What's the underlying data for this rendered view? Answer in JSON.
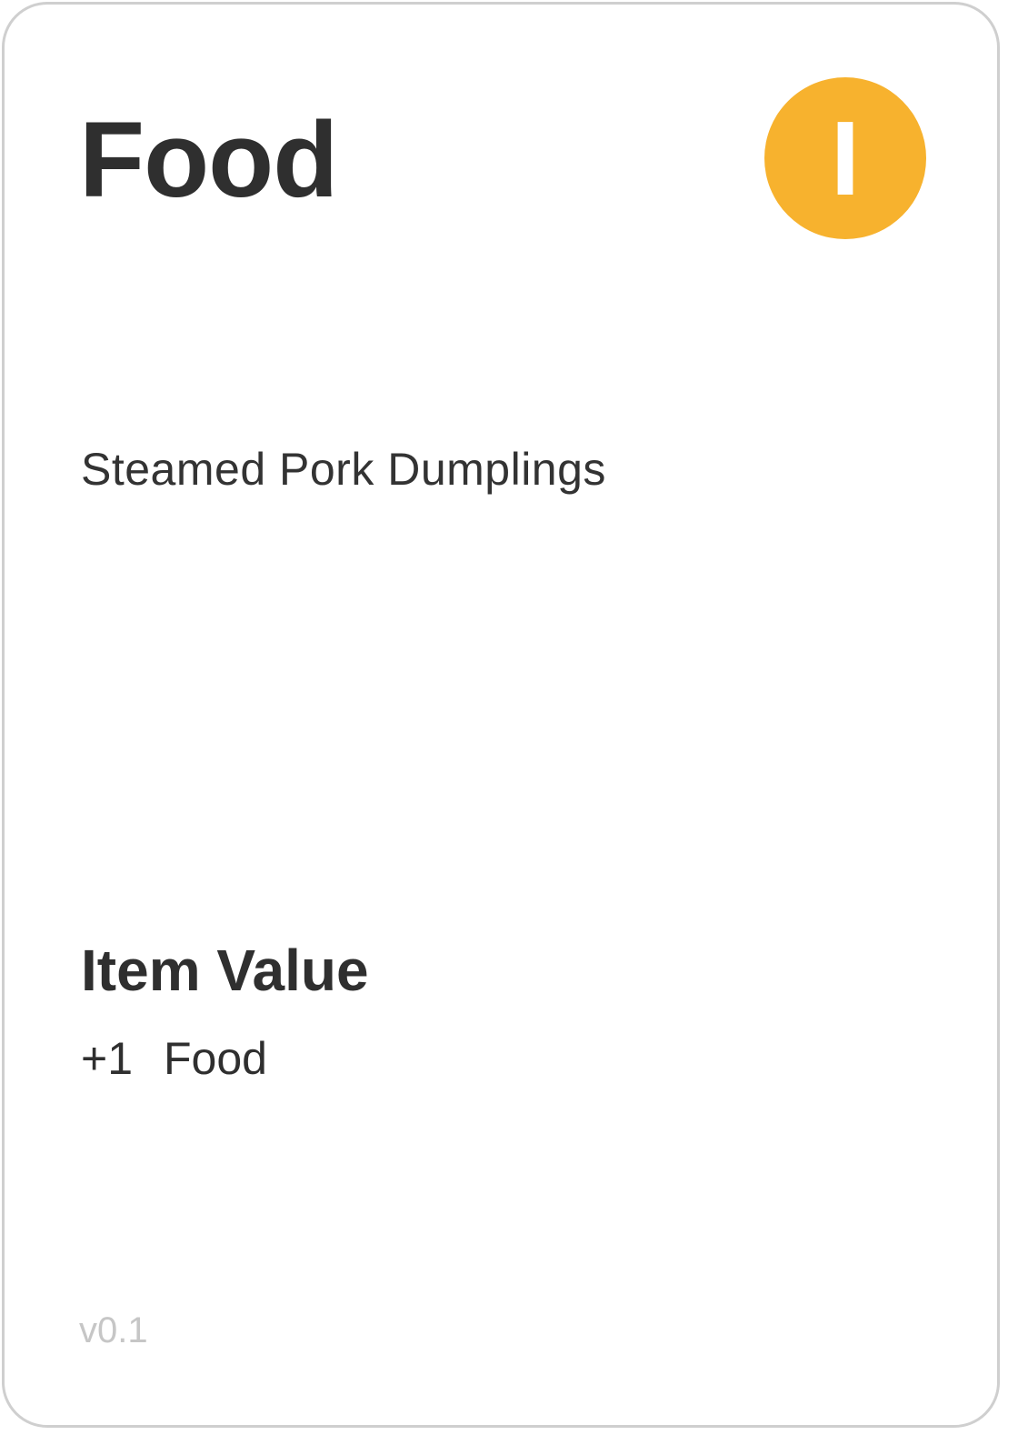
{
  "card": {
    "title": "Food",
    "tier": "I",
    "tier_color": "#f7b22e",
    "subtitle": "Steamed Pork Dumplings",
    "section_title": "Item Value",
    "value": {
      "amount": "+1",
      "resource": "Food"
    },
    "version": "v0.1"
  }
}
